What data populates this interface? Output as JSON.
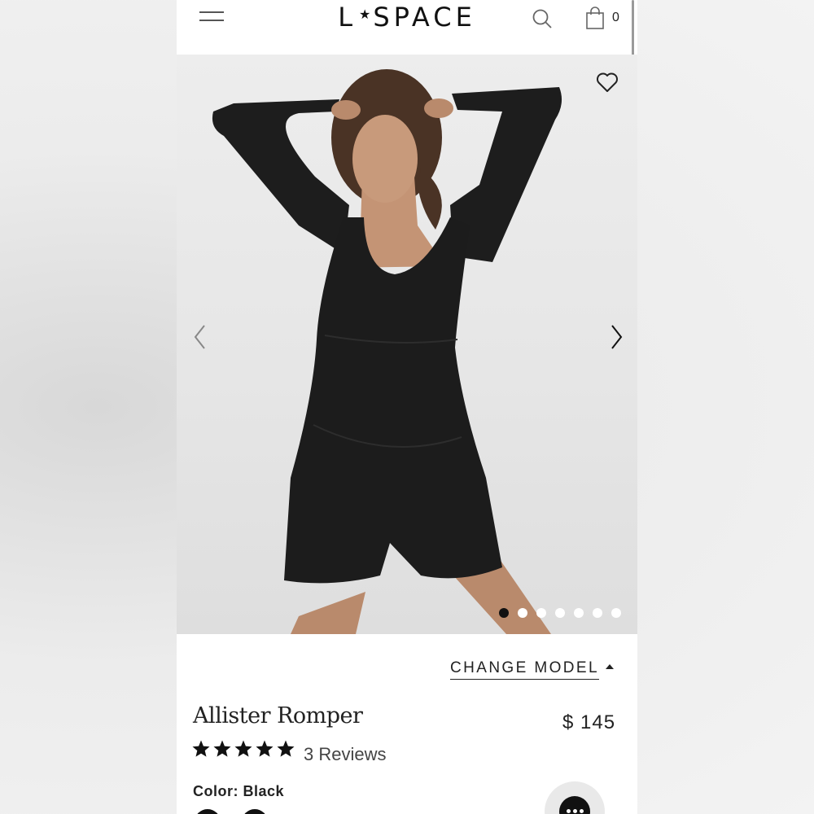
{
  "header": {
    "logo_left": "L",
    "logo_star": "★",
    "logo_right": "SPACE",
    "cart_count": "0",
    "icons": [
      "menu-icon",
      "search-icon",
      "shopping-bag-icon"
    ]
  },
  "gallery": {
    "icons": [
      "heart-icon",
      "chevron-left-icon",
      "chevron-right-icon"
    ],
    "slide_count": 7,
    "active_slide": 1
  },
  "product": {
    "change_model_label": "CHANGE MODEL",
    "name": "Allister Romper",
    "price": "$ 145",
    "rating": 5,
    "reviews_label": "3 Reviews",
    "color_label": "Color:",
    "color_value": "Black"
  },
  "colors": {
    "garment": "#1c1c1c",
    "accent": "#111111",
    "background": "#ffffff"
  }
}
